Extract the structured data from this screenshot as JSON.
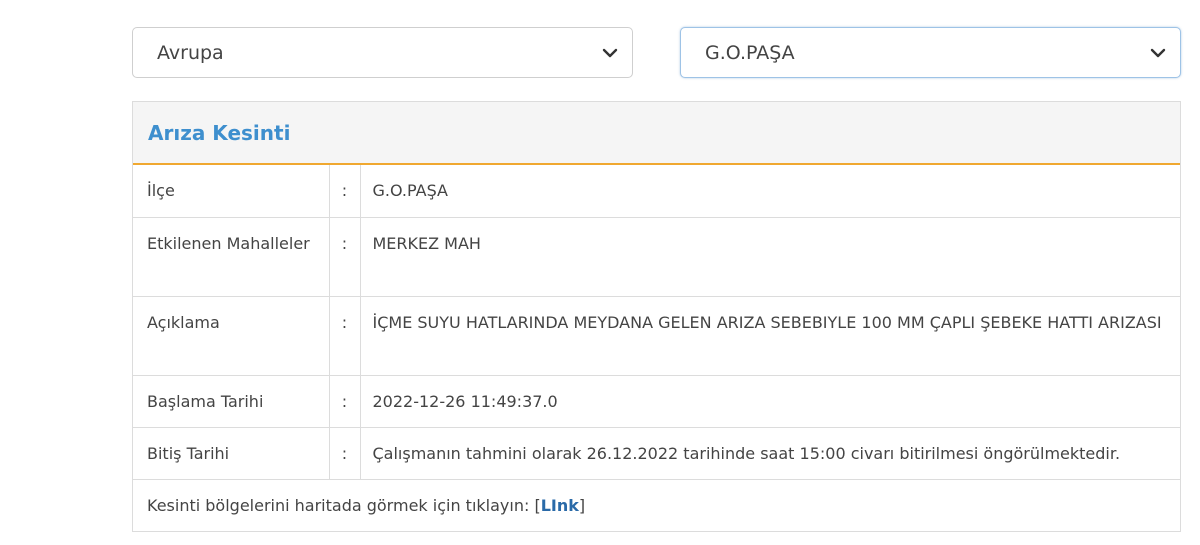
{
  "filters": {
    "region_value": "Avrupa",
    "district_value": "G.O.PAŞA"
  },
  "panel": {
    "title": "Arıza Kesinti",
    "separator": ":",
    "rows": [
      {
        "label": "İlçe",
        "value": "G.O.PAŞA"
      },
      {
        "label": "Etkilenen Mahalleler",
        "value": "MERKEZ MAH"
      },
      {
        "label": "Açıklama",
        "value": "İÇME SUYU HATLARINDA MEYDANA GELEN ARIZA SEBEBIYLE 100 MM ÇAPLI ŞEBEKE HATTI ARIZASI"
      },
      {
        "label": "Başlama Tarihi",
        "value": "2022-12-26 11:49:37.0"
      },
      {
        "label": "Bitiş Tarihi",
        "value": "Çalışmanın tahmini olarak 26.12.2022 tarihinde saat 15:00 civarı bitirilmesi öngörülmektedir."
      }
    ],
    "footer_text": "Kesinti bölgelerini haritada görmek için tıklayın: ",
    "footer_bracket_open": "[",
    "footer_link": "LInk",
    "footer_bracket_close": "]"
  },
  "colors": {
    "title": "#3e8fce",
    "accent_border": "#f0a830",
    "link": "#2a6aa8"
  }
}
